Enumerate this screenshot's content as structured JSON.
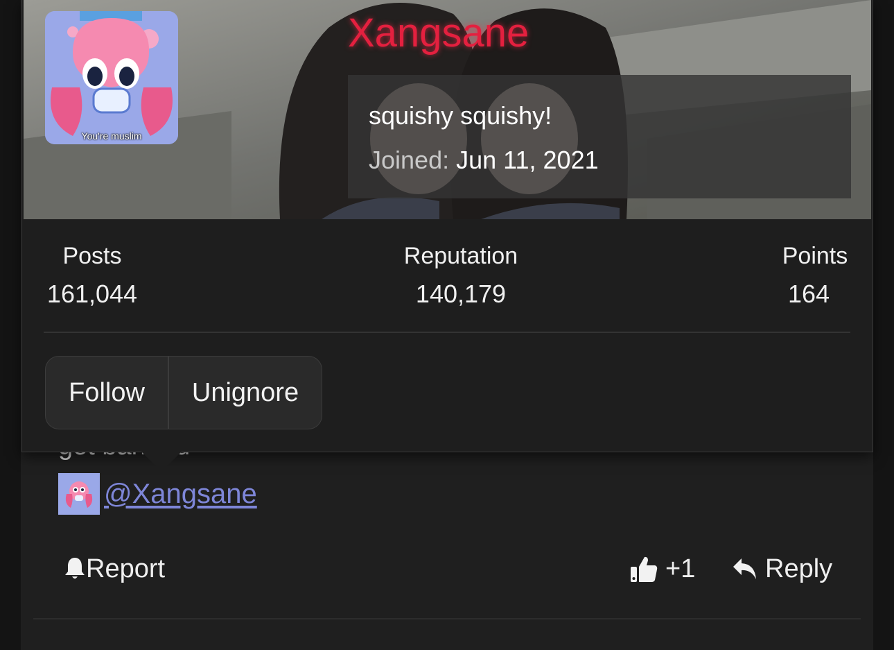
{
  "user": {
    "name": "Xangsane",
    "title": "squishy squishy!",
    "joined_label": "Joined:",
    "joined_date": "Jun 11, 2021",
    "avatar_caption": "You're muslim",
    "name_color": "#e4203f"
  },
  "stats": [
    {
      "label": "Posts",
      "value": "161,044"
    },
    {
      "label": "Reputation",
      "value": "140,179"
    },
    {
      "label": "Points",
      "value": "164"
    }
  ],
  "buttons": {
    "follow": "Follow",
    "unignore": "Unignore"
  },
  "post": {
    "partial_text": "get banned",
    "mention": "@Xangsane",
    "mention_color": "#7e86d8"
  },
  "actions": {
    "report": "Report",
    "like_count": "+1",
    "reply": "Reply"
  },
  "icons": [
    "bell-icon",
    "thumbs-up-icon",
    "reply-arrow-icon"
  ]
}
